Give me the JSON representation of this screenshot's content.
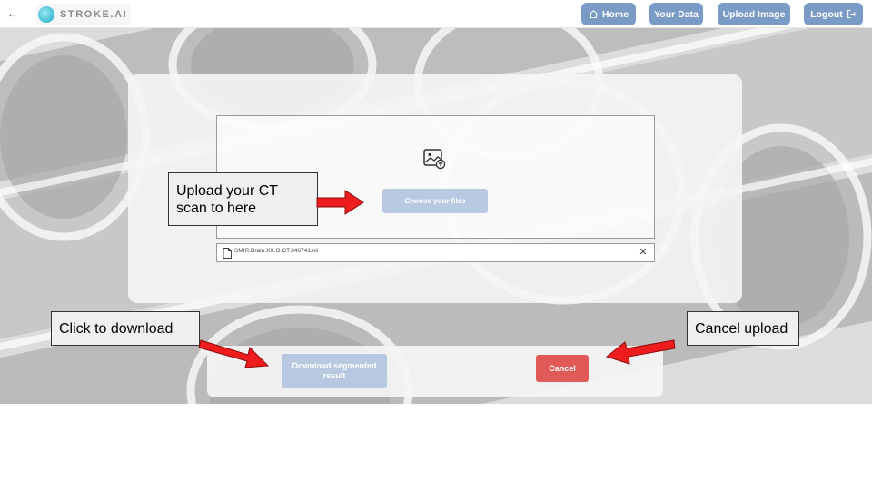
{
  "header": {
    "back_icon": "arrow-left-icon",
    "brand_name": "STROKE.AI",
    "nav": {
      "home": "Home",
      "your_data": "Your Data",
      "upload_image": "Upload Image",
      "logout": "Logout"
    }
  },
  "upload": {
    "choose_label": "Choose your files",
    "file_name": "SMIR.Brain.XX.O.CT.346741.nii",
    "remove_icon": "close-icon"
  },
  "actions": {
    "download_label": "Download segmented result",
    "cancel_label": "Cancel"
  },
  "annotations": {
    "upload_hint": "Upload your CT scan to here",
    "download_hint": "Click to download",
    "cancel_hint": "Cancel upload"
  },
  "colors": {
    "nav_button": "#7a9bc6",
    "choose_button": "#b9c9e1",
    "download_button": "#b7c8e0",
    "cancel_button": "#e05a58",
    "arrow": "#ee1c1c",
    "brand_logo": "#46c4d6"
  }
}
